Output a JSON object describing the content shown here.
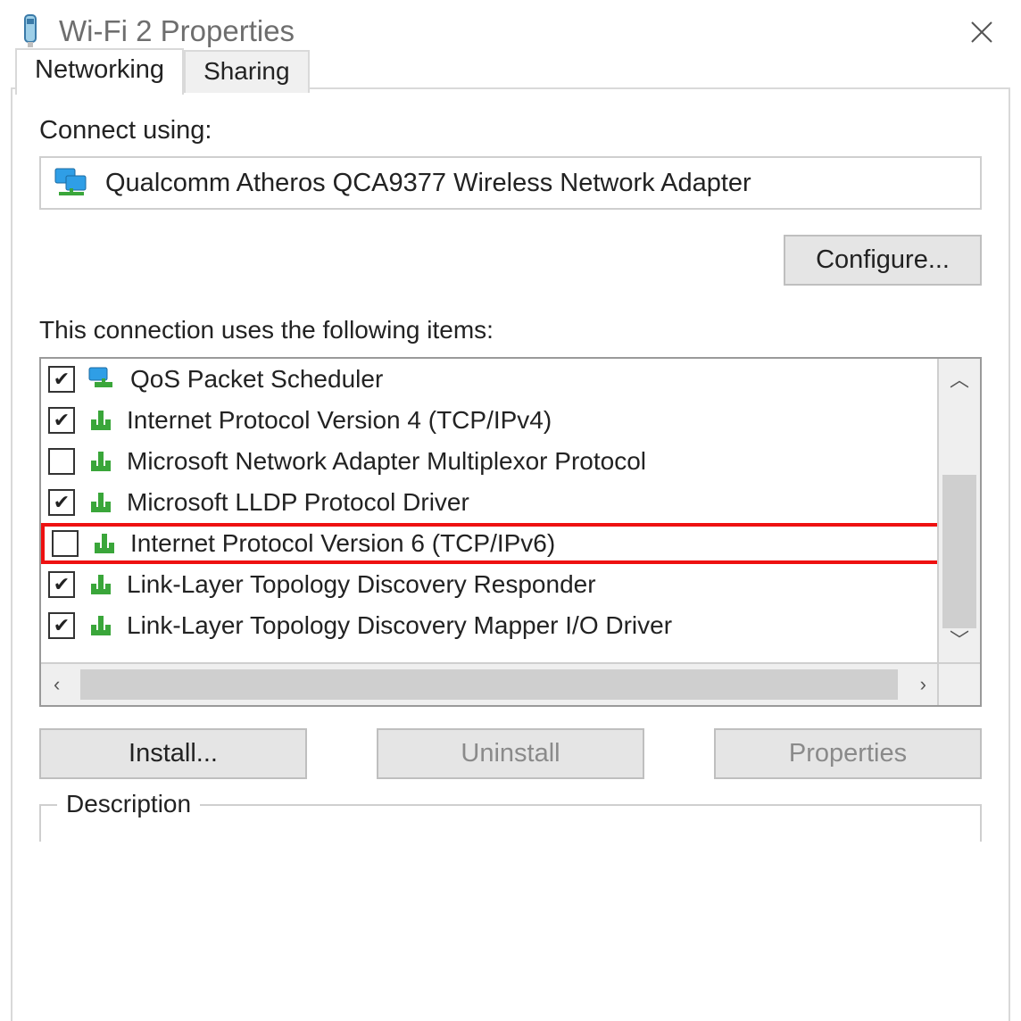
{
  "window": {
    "title": "Wi-Fi 2 Properties"
  },
  "tabs": {
    "networking": "Networking",
    "sharing": "Sharing"
  },
  "labels": {
    "connect_using": "Connect using:",
    "items_label": "This connection uses the following items:",
    "description": "Description"
  },
  "adapter": {
    "name": "Qualcomm Atheros QCA9377 Wireless Network Adapter"
  },
  "buttons": {
    "configure": "Configure...",
    "install": "Install...",
    "uninstall": "Uninstall",
    "properties": "Properties"
  },
  "items": [
    {
      "checked": true,
      "icon": "qos",
      "label": "QoS Packet Scheduler",
      "highlight": false
    },
    {
      "checked": true,
      "icon": "protocol",
      "label": "Internet Protocol Version 4 (TCP/IPv4)",
      "highlight": false
    },
    {
      "checked": false,
      "icon": "protocol",
      "label": "Microsoft Network Adapter Multiplexor Protocol",
      "highlight": false
    },
    {
      "checked": true,
      "icon": "protocol",
      "label": "Microsoft LLDP Protocol Driver",
      "highlight": false
    },
    {
      "checked": false,
      "icon": "protocol",
      "label": "Internet Protocol Version 6 (TCP/IPv6)",
      "highlight": true
    },
    {
      "checked": true,
      "icon": "protocol",
      "label": "Link-Layer Topology Discovery Responder",
      "highlight": false
    },
    {
      "checked": true,
      "icon": "protocol",
      "label": "Link-Layer Topology Discovery Mapper I/O Driver",
      "highlight": false
    }
  ]
}
